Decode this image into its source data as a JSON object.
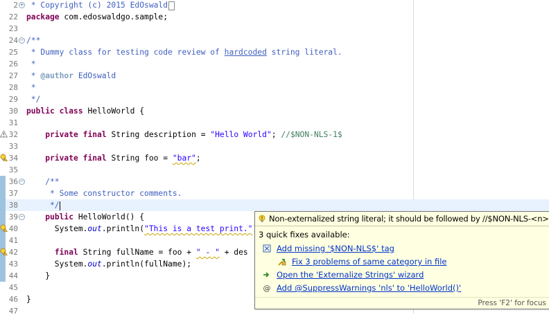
{
  "editor": {
    "lines": [
      {
        "num": "2",
        "segments": [
          {
            "t": " * Copyright (c) 2015 EdOswald",
            "c": "cm"
          }
        ],
        "fold": "plus",
        "ghost_box": true
      },
      {
        "num": "22",
        "segments": [
          {
            "t": "package",
            "c": "kw"
          },
          {
            "t": " com.edoswaldgo.sample;",
            "c": ""
          }
        ]
      },
      {
        "num": "23",
        "segments": []
      },
      {
        "num": "24",
        "segments": [
          {
            "t": "/**",
            "c": "cm"
          }
        ],
        "fold": "minus"
      },
      {
        "num": "25",
        "segments": [
          {
            "t": " * Dummy class for testing code review of ",
            "c": "cm"
          },
          {
            "t": "hardcoded",
            "c": "cm spell-ul"
          },
          {
            "t": " string literal.",
            "c": "cm"
          }
        ]
      },
      {
        "num": "26",
        "segments": [
          {
            "t": " *",
            "c": "cm"
          }
        ]
      },
      {
        "num": "27",
        "segments": [
          {
            "t": " * ",
            "c": "cm"
          },
          {
            "t": "@author",
            "c": "tag"
          },
          {
            "t": " EdOswald",
            "c": "cm"
          }
        ]
      },
      {
        "num": "28",
        "segments": [
          {
            "t": " *",
            "c": "cm"
          }
        ]
      },
      {
        "num": "29",
        "segments": [
          {
            "t": " */",
            "c": "cm"
          }
        ]
      },
      {
        "num": "30",
        "segments": [
          {
            "t": "public",
            "c": "kw"
          },
          {
            "t": " ",
            "c": ""
          },
          {
            "t": "class",
            "c": "kw"
          },
          {
            "t": " HelloWorld {",
            "c": ""
          }
        ]
      },
      {
        "num": "31",
        "segments": []
      },
      {
        "num": "32",
        "segments": [
          {
            "t": "    ",
            "c": ""
          },
          {
            "t": "private",
            "c": "kw"
          },
          {
            "t": " ",
            "c": ""
          },
          {
            "t": "final",
            "c": "kw"
          },
          {
            "t": " String ",
            "c": ""
          },
          {
            "t": "description",
            "c": "field-plain"
          },
          {
            "t": " = ",
            "c": ""
          },
          {
            "t": "\"Hello World\"",
            "c": "str"
          },
          {
            "t": "; ",
            "c": ""
          },
          {
            "t": "//$NON-NLS-1$",
            "c": "nls"
          }
        ],
        "marker": "warning"
      },
      {
        "num": "33",
        "segments": []
      },
      {
        "num": "34",
        "segments": [
          {
            "t": "    ",
            "c": ""
          },
          {
            "t": "private",
            "c": "kw"
          },
          {
            "t": " ",
            "c": ""
          },
          {
            "t": "final",
            "c": "kw"
          },
          {
            "t": " String foo = ",
            "c": ""
          },
          {
            "t": "\"bar\"",
            "c": "str warn-ul"
          },
          {
            "t": ";",
            "c": ""
          }
        ],
        "marker": "quickfix"
      },
      {
        "num": "35",
        "segments": []
      },
      {
        "num": "36",
        "segments": [
          {
            "t": "    /**",
            "c": "cm"
          }
        ],
        "fold": "minus",
        "changed": true
      },
      {
        "num": "37",
        "segments": [
          {
            "t": "     * Some constructor comments.",
            "c": "cm"
          }
        ],
        "changed": true
      },
      {
        "num": "38",
        "segments": [
          {
            "t": "     */",
            "c": "cm"
          }
        ],
        "changed": true,
        "current": true,
        "cursor": true
      },
      {
        "num": "39",
        "segments": [
          {
            "t": "    ",
            "c": ""
          },
          {
            "t": "public",
            "c": "kw"
          },
          {
            "t": " HelloWorld() {",
            "c": ""
          }
        ],
        "fold": "minus",
        "changed": true
      },
      {
        "num": "40",
        "segments": [
          {
            "t": "      System.",
            "c": ""
          },
          {
            "t": "out",
            "c": "field"
          },
          {
            "t": ".println(",
            "c": ""
          },
          {
            "t": "\"This is a test print.\"",
            "c": "str warn-ul"
          },
          {
            "t": ");",
            "c": ""
          }
        ],
        "marker": "quickfix",
        "changed": true
      },
      {
        "num": "41",
        "segments": [],
        "changed": true
      },
      {
        "num": "42",
        "segments": [
          {
            "t": "      ",
            "c": ""
          },
          {
            "t": "final",
            "c": "kw"
          },
          {
            "t": " String fullName = foo + ",
            "c": ""
          },
          {
            "t": "\" - \"",
            "c": "str warn-ul"
          },
          {
            "t": " + des",
            "c": ""
          }
        ],
        "marker": "quickfix",
        "changed": true
      },
      {
        "num": "43",
        "segments": [
          {
            "t": "      System.",
            "c": ""
          },
          {
            "t": "out",
            "c": "field"
          },
          {
            "t": ".println(fullName);",
            "c": ""
          }
        ],
        "changed": true
      },
      {
        "num": "44",
        "segments": [
          {
            "t": "    }",
            "c": ""
          }
        ],
        "changed": true
      },
      {
        "num": "45",
        "segments": []
      },
      {
        "num": "46",
        "segments": [
          {
            "t": "}",
            "c": ""
          }
        ]
      },
      {
        "num": "47",
        "segments": []
      }
    ]
  },
  "popup": {
    "message": "Non-externalized string literal; it should be followed by //$NON-NLS-<n>$",
    "quick_fix_count": "3 quick fixes available:",
    "fixes": [
      {
        "label": "Add missing '$NON-NLS$' tag",
        "icon": "nls-tag-icon"
      },
      {
        "label": "Fix 3 problems of same category in file",
        "icon": "multi-fix-icon"
      },
      {
        "label": "Open the 'Externalize Strings' wizard",
        "icon": "wizard-arrow-icon"
      },
      {
        "label": "Add @SuppressWarnings 'nls' to 'HelloWorld()'",
        "icon": "annotation-at-icon"
      }
    ],
    "focus_hint": "Press 'F2' for focus"
  },
  "colors": {
    "keyword": "#7f0055",
    "comment": "#3f5fbf",
    "string": "#2a00ff",
    "popup_bg": "#ffffe1",
    "link": "#0033cc",
    "change_bar": "#9ec3df"
  }
}
